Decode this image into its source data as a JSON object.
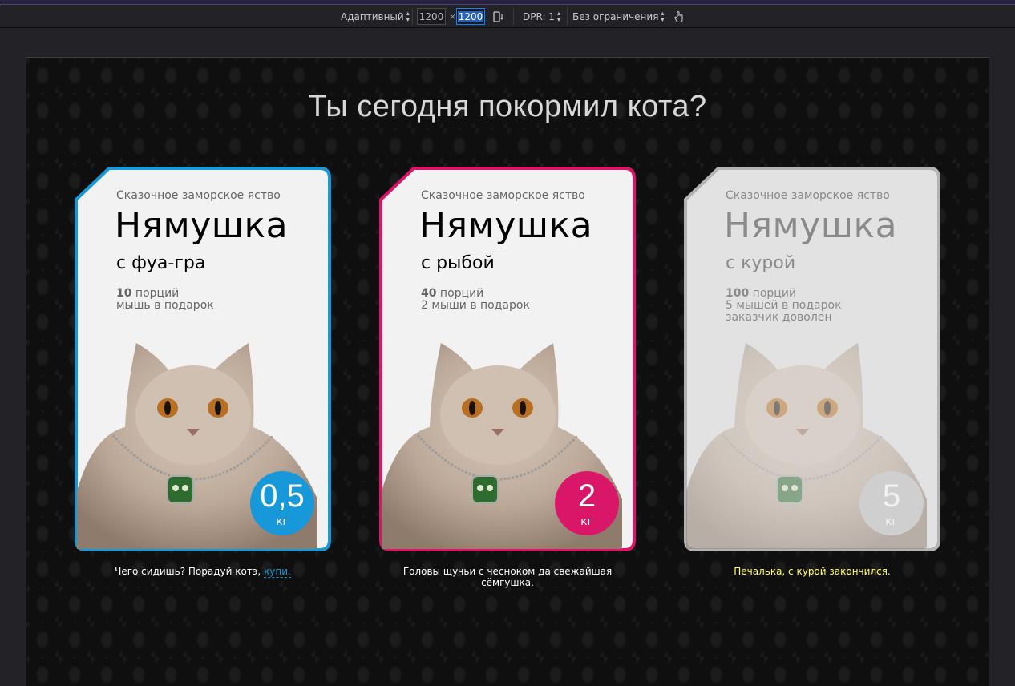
{
  "toolbar": {
    "device_label": "Адаптивный",
    "width": "1200",
    "height": "1200",
    "times": "×",
    "dpr_label": "DPR: 1",
    "throttle_label": "Без ограничения"
  },
  "page": {
    "headline": "Ты сегодня покормил кота?"
  },
  "colors": {
    "blue": "#1698d9",
    "pink": "#d91667",
    "gray": "#b3b3b3",
    "caption_yellow": "#ffff66"
  },
  "cards": [
    {
      "tagline": "Сказочное заморское яство",
      "name": "Нямушка",
      "flavor": "с фуа-гра",
      "portions_num": "10",
      "portions_text": " порций",
      "gift": "мышь в подарок",
      "extra": "",
      "weight": "0,5",
      "unit": "кг",
      "caption_text": "Чего сидишь? Порадуй котэ, ",
      "caption_link": "купи.",
      "state": "default"
    },
    {
      "tagline": "Сказочное заморское яство",
      "name": "Нямушка",
      "flavor": "с рыбой",
      "portions_num": "40",
      "portions_text": " порций",
      "gift": "2 мыши в подарок",
      "extra": "",
      "weight": "2",
      "unit": "кг",
      "caption_text": "Головы щучьи с чесноком да свежайшая сёмгушка.",
      "caption_link": "",
      "state": "selected"
    },
    {
      "tagline": "Сказочное заморское яство",
      "name": "Нямушка",
      "flavor": "с курой",
      "portions_num": "100",
      "portions_text": " порций",
      "gift": "5 мышей в подарок",
      "extra": "заказчик доволен",
      "weight": "5",
      "unit": "кг",
      "caption_text": "Печалька, с курой закончился.",
      "caption_link": "",
      "state": "disabled"
    }
  ]
}
